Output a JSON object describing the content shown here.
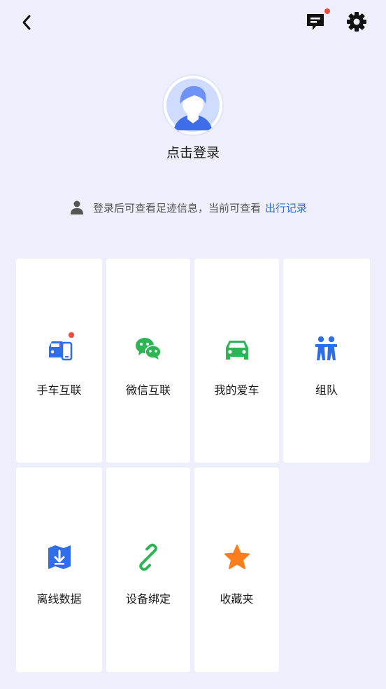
{
  "header": {
    "back_icon": "chevron-left-icon",
    "message_icon": "message-icon",
    "settings_icon": "gear-icon",
    "message_badge_color": "#f04a3c"
  },
  "profile": {
    "login_label": "点击登录",
    "avatar_icon": "user-avatar-icon"
  },
  "hint": {
    "text": "登录后可查看足迹信息，当前可查看",
    "link": "出行记录",
    "link_color": "#2f6ee8"
  },
  "grid": {
    "items": [
      {
        "label": "手车互联",
        "icon": "phone-car-icon",
        "badge": true
      },
      {
        "label": "微信互联",
        "icon": "wechat-icon",
        "badge": false
      },
      {
        "label": "我的爱车",
        "icon": "car-icon",
        "badge": false
      },
      {
        "label": "组队",
        "icon": "team-icon",
        "badge": false
      },
      {
        "label": "离线数据",
        "icon": "offline-map-icon",
        "badge": false
      },
      {
        "label": "设备绑定",
        "icon": "link-icon",
        "badge": false
      },
      {
        "label": "收藏夹",
        "icon": "star-icon",
        "badge": false
      }
    ]
  },
  "colors": {
    "background": "#eeeefc",
    "blue": "#2f6ee8",
    "green": "#2fb455",
    "orange": "#fa7d1e",
    "red": "#f04a3c"
  }
}
